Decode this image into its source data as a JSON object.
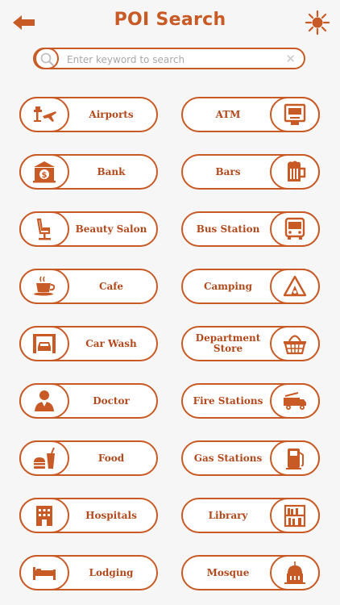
{
  "header": {
    "title": "POI Search",
    "back_icon": "back-arrow-icon",
    "settings_icon": "sun-settings-icon"
  },
  "search": {
    "placeholder": "Enter keyword to search",
    "value": "",
    "clear_glyph": "✕"
  },
  "colors": {
    "accent": "#c75a25",
    "text": "#b2491c",
    "background": "#f6f6f6"
  },
  "poi": [
    {
      "label": "Airports",
      "icon": "airport-icon"
    },
    {
      "label": "ATM",
      "icon": "atm-icon"
    },
    {
      "label": "Bank",
      "icon": "bank-icon"
    },
    {
      "label": "Bars",
      "icon": "beer-mug-icon"
    },
    {
      "label": "Beauty Salon",
      "icon": "salon-chair-icon"
    },
    {
      "label": "Bus Station",
      "icon": "bus-icon"
    },
    {
      "label": "Cafe",
      "icon": "coffee-cup-icon"
    },
    {
      "label": "Camping",
      "icon": "tent-icon"
    },
    {
      "label": "Car Wash",
      "icon": "car-wash-icon"
    },
    {
      "label": "Department Store",
      "icon": "shopping-basket-icon"
    },
    {
      "label": "Doctor",
      "icon": "doctor-icon"
    },
    {
      "label": "Fire Stations",
      "icon": "fire-truck-icon"
    },
    {
      "label": "Food",
      "icon": "fast-food-icon"
    },
    {
      "label": "Gas Stations",
      "icon": "gas-pump-icon"
    },
    {
      "label": "Hospitals",
      "icon": "hospital-building-icon"
    },
    {
      "label": "Library",
      "icon": "bookshelf-icon"
    },
    {
      "label": "Lodging",
      "icon": "bed-icon"
    },
    {
      "label": "Mosque",
      "icon": "mosque-icon"
    }
  ]
}
